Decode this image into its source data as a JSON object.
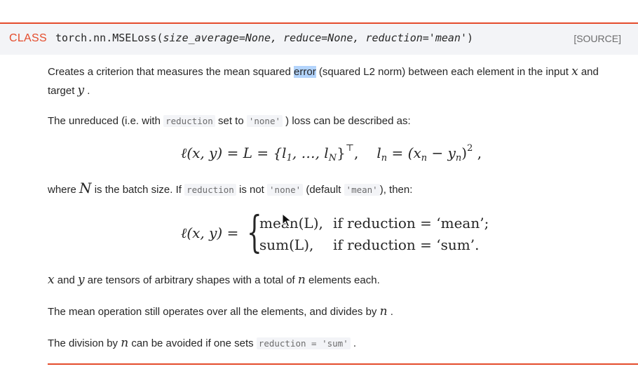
{
  "signature": {
    "kind": "CLASS",
    "name": "torch.nn.MSELoss",
    "open": "(",
    "params": "size_average=None, reduce=None, reduction='mean'",
    "close": ")",
    "source": "[SOURCE]"
  },
  "p1": {
    "a": "Creates a criterion that measures the mean squared ",
    "hl": "error",
    "b": " (squared L2 norm) between each element in the input ",
    "x": "x",
    "c": " and",
    "d": "target ",
    "y": "y",
    "e": " ."
  },
  "p2": {
    "a": "The unreduced (i.e. with ",
    "code1": "reduction",
    "b": " set to ",
    "code2": "'none'",
    "c": " ) loss can be described as:"
  },
  "eq1": {
    "left": "ℓ(x, y) = L = {l",
    "sub1": "1",
    "mid": ", …, l",
    "subN": "N",
    "close": "}",
    "sup": "⊤",
    "sep": ",",
    "l": "l",
    "subn": "n",
    "rhs": " = (x",
    "subn2": "n",
    "minus": " − y",
    "subn3": "n",
    "rclose": ")",
    "sq": "2",
    "end": " ,"
  },
  "p3": {
    "a": "where ",
    "N": "N",
    "b": " is the batch size. If ",
    "code1": "reduction",
    "c": " is not ",
    "code2": "'none'",
    "d": " (default ",
    "code3": "'mean'",
    "e": "), then:"
  },
  "eq2": {
    "left": "ℓ(x, y) =",
    "row1a": "mean(L),",
    "row1b": "if reduction = ‘mean’;",
    "row2a": "sum(L),",
    "row2b": "if reduction = ‘sum’."
  },
  "p4": {
    "x": "x",
    "a": " and ",
    "y": "y",
    "b": " are tensors of arbitrary shapes with a total of ",
    "n": "n",
    "c": " elements each."
  },
  "p5": {
    "a": "The mean operation still operates over all the elements, and divides by ",
    "n": "n",
    "b": " ."
  },
  "p6": {
    "a": "The division by ",
    "n": "n",
    "b": " can be avoided if one sets ",
    "code1": "reduction = 'sum'",
    "c": " ."
  },
  "colors": {
    "accent": "#e44c2c",
    "code_bg": "#f3f4f7",
    "selection": "#b3d4fc"
  },
  "icons": [
    "mouse-pointer-icon"
  ]
}
